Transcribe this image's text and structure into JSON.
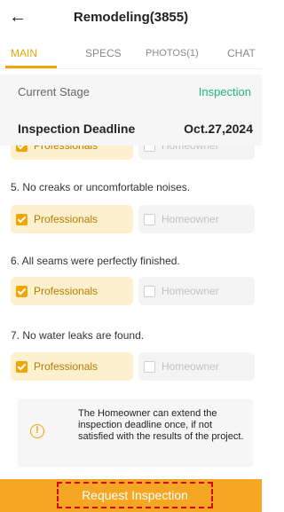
{
  "header": {
    "back_icon": "arrow-left-icon",
    "title": "Remodeling(3855)"
  },
  "tabs": [
    {
      "label": "MAIN",
      "active": true
    },
    {
      "label": "SPECS",
      "active": false
    },
    {
      "label": "PHOTOS(1)",
      "active": false
    },
    {
      "label": "CHAT",
      "active": false
    }
  ],
  "stage": {
    "label": "Current Stage",
    "value": "Inspection"
  },
  "deadline": {
    "label": "Inspection Deadline",
    "value": "Oct.27,2024"
  },
  "checklist": {
    "professionals_label": "Professionals",
    "homeowner_label": "Homeowner",
    "items": [
      {
        "text": "5. No creaks or uncomfortable noises."
      },
      {
        "text": "6. All seams were perfectly finished."
      },
      {
        "text": "7. No water leaks are found."
      }
    ]
  },
  "notice": {
    "icon": "info-circle-icon",
    "text": "The Homeowner can extend the inspection deadline once, if not satisfied with the results of the project."
  },
  "actions": {
    "request_label": "Request Inspection"
  },
  "colors": {
    "accent": "#f5a623",
    "stage": "#25b37a",
    "highlight": "#e00000"
  }
}
